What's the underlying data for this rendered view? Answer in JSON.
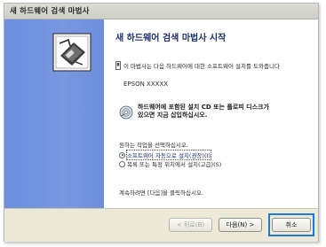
{
  "window": {
    "title": "새 하드웨어 검색 마법사"
  },
  "icons": {
    "wizard": "hardware-wizard-icon",
    "intro": "info-icon",
    "cd": "cd-disc-icon"
  },
  "colors": {
    "sidebar": "#6c8ede",
    "heading": "#1b2f6e",
    "highlight": "#1e7ad6"
  },
  "content": {
    "heading": "새 하드웨어 검색 마법사 시작",
    "intro": "이 마법사는 다음 하드웨어에 대한 소프트웨어 설치를 도와줍니다",
    "device": "EPSON XXXXX",
    "cd_line1": "하드웨어에 포함된 설치 CD 또는 플로피 디스크가",
    "cd_line2": "있으면 지금 삽입하십시오.",
    "prompt": "원하는 작업을 선택하십시오.",
    "options": [
      {
        "label": "소프트웨어 자동으로 설치(권장)(I)",
        "selected": true
      },
      {
        "label": "목록 또는 특정 위치에서 설치(고급)(S)",
        "selected": false
      }
    ],
    "continue_text": "계속하려면 [다음]을 클릭하십시오."
  },
  "buttons": {
    "back": "< 뒤로(B)",
    "next": "다음(N) >",
    "cancel": "취소"
  }
}
